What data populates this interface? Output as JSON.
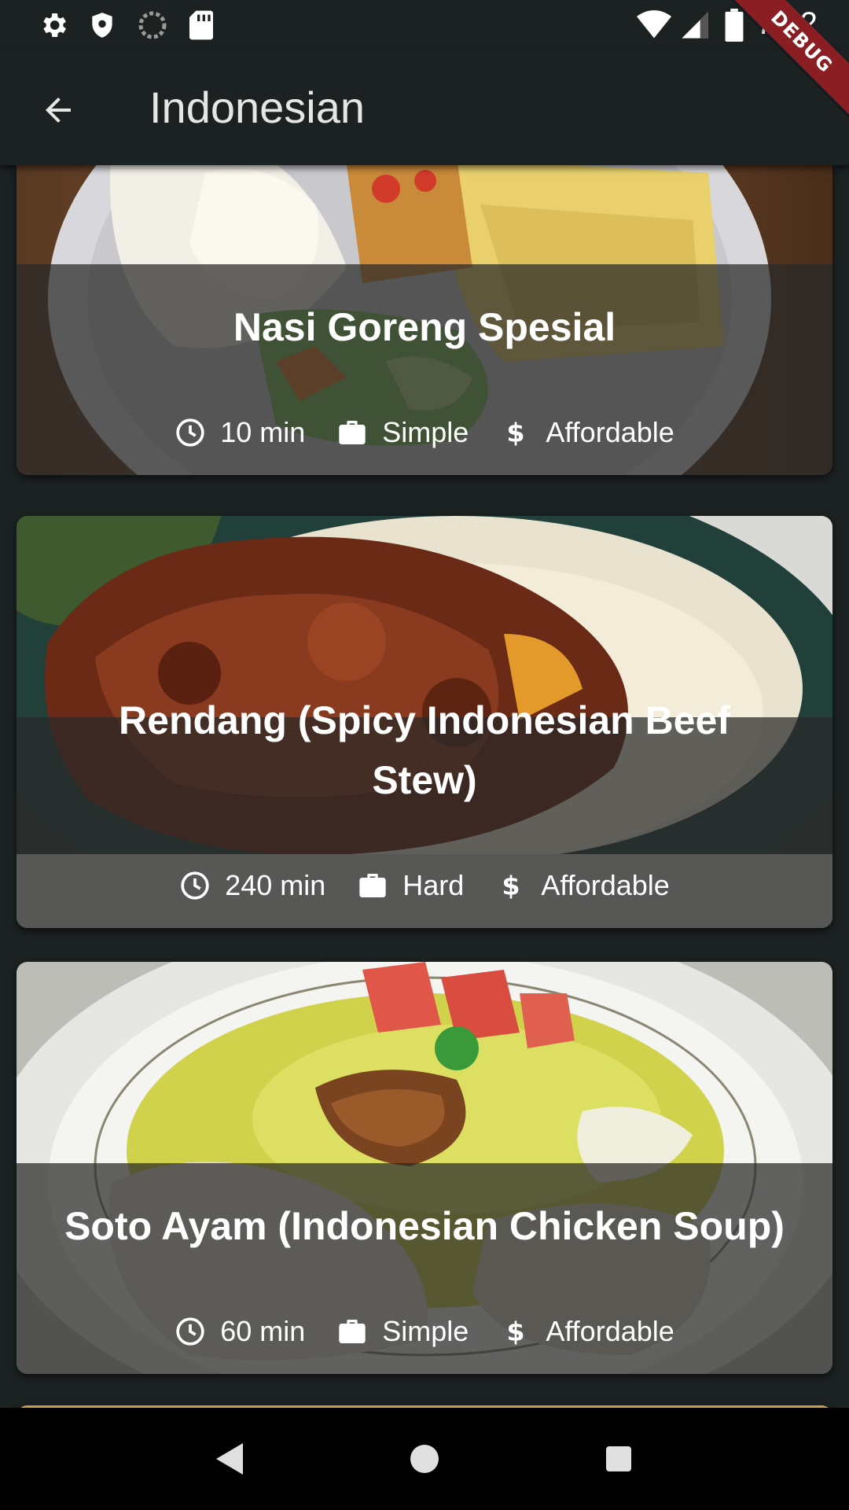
{
  "status_bar": {
    "time": "7:42",
    "left_icons": [
      "settings-icon",
      "shield-icon",
      "sync-icon",
      "sd-card-icon"
    ],
    "right_icons": [
      "wifi-icon",
      "signal-icon",
      "battery-icon"
    ]
  },
  "debug_banner": "DEBUG",
  "app_bar": {
    "title": "Indonesian",
    "back_icon": "arrow-back-icon"
  },
  "meals": [
    {
      "title": "Nasi Goreng Spesial",
      "duration": "10 min",
      "complexity": "Simple",
      "affordability": "Affordable"
    },
    {
      "title": "Rendang (Spicy Indonesian Beef Stew)",
      "duration": "240 min",
      "complexity": "Hard",
      "affordability": "Affordable"
    },
    {
      "title": "Soto Ayam (Indonesian Chicken Soup)",
      "duration": "60 min",
      "complexity": "Simple",
      "affordability": "Affordable"
    }
  ],
  "nav_bar": [
    "back-triangle-icon",
    "home-circle-icon",
    "recents-square-icon"
  ],
  "colors": {
    "background": "#1c2222",
    "overlay": "#282828",
    "debug": "#8b1e22"
  }
}
